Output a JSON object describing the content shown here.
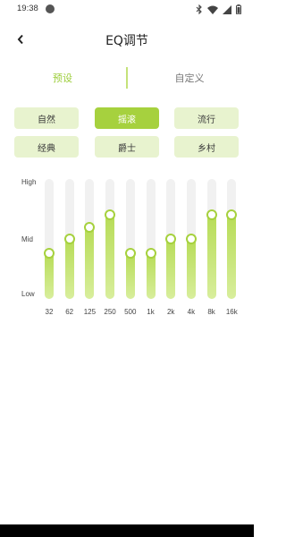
{
  "status_bar": {
    "time": "19:38",
    "icons": [
      "bluetooth-icon",
      "wifi-icon",
      "signal-icon",
      "battery-icon"
    ]
  },
  "header": {
    "title": "EQ调节",
    "back_icon": "chevron-left-icon"
  },
  "tabs": [
    {
      "label": "预设",
      "active": true
    },
    {
      "label": "自定义",
      "active": false
    }
  ],
  "presets": [
    {
      "label": "自然",
      "active": false
    },
    {
      "label": "摇滚",
      "active": true
    },
    {
      "label": "流行",
      "active": false
    },
    {
      "label": "经典",
      "active": false
    },
    {
      "label": "爵士",
      "active": false
    },
    {
      "label": "乡村",
      "active": false
    }
  ],
  "eq": {
    "levels": {
      "high": "High",
      "mid": "Mid",
      "low": "Low"
    },
    "bands": [
      {
        "freq": "32",
        "level": 0.38
      },
      {
        "freq": "62",
        "level": 0.5
      },
      {
        "freq": "125",
        "level": 0.6
      },
      {
        "freq": "250",
        "level": 0.7
      },
      {
        "freq": "500",
        "level": 0.38
      },
      {
        "freq": "1k",
        "level": 0.38
      },
      {
        "freq": "2k",
        "level": 0.5
      },
      {
        "freq": "4k",
        "level": 0.5
      },
      {
        "freq": "8k",
        "level": 0.7
      },
      {
        "freq": "16k",
        "level": 0.7
      }
    ]
  },
  "colors": {
    "accent": "#a6d13e",
    "preset_bg": "#e8f3cf",
    "tab_active": "#9ccd3a"
  }
}
